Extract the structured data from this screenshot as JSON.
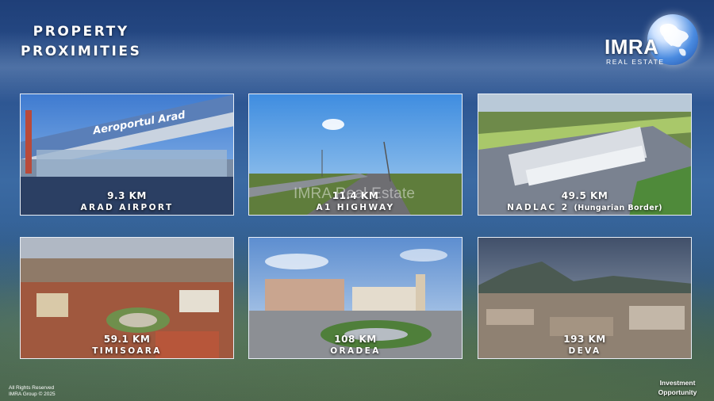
{
  "header": {
    "title_line1": "PROPERTY",
    "title_line2": "PROXIMITIES"
  },
  "logo": {
    "brand": "IMRA",
    "tagline": "REAL ESTATE",
    "icon": "globe-icon"
  },
  "watermark": "IMRA Real Estate",
  "cards": [
    {
      "distance": "9.3 KM",
      "name": "ARAD AIRPORT",
      "sign_text": "Aeroportul Arad"
    },
    {
      "distance": "11.4 KM",
      "name": "A1 HIGHWAY"
    },
    {
      "distance": "49.5 KM",
      "name": "NADLAC 2",
      "note": "(Hungarian Border)"
    },
    {
      "distance": "59.1 KM",
      "name": "TIMISOARA"
    },
    {
      "distance": "108 KM",
      "name": "ORADEA"
    },
    {
      "distance": "193 KM",
      "name": "DEVA"
    }
  ],
  "footer": {
    "rights": "All Rights Reserved",
    "copyright": "IMRA Group © 2025"
  },
  "badge": {
    "line1": "Investment",
    "line2": "Opportunity"
  },
  "colors": {
    "background": "#2e5a8c",
    "card_border": "#e8eef6",
    "globe": "#4a8be0"
  }
}
